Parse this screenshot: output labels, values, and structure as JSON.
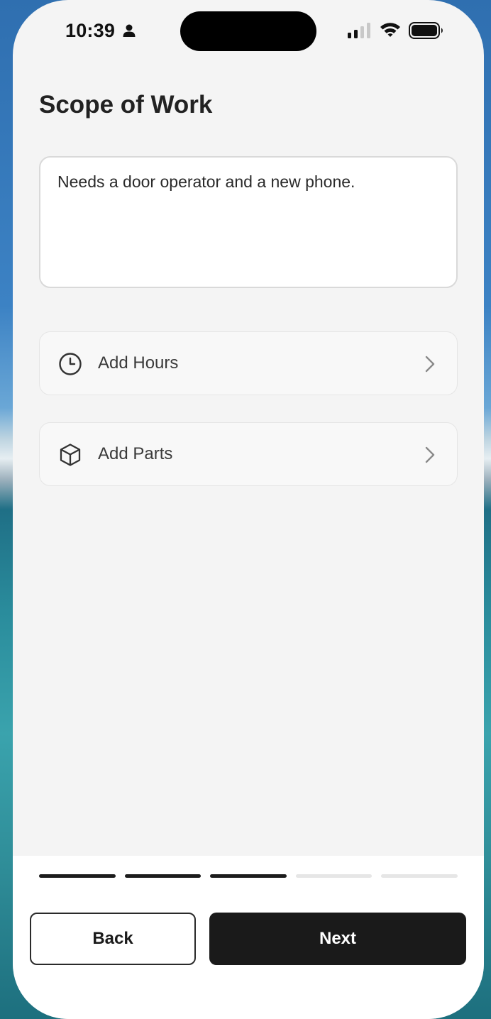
{
  "status_bar": {
    "time": "10:39",
    "icons": [
      "person-icon",
      "signal-icon",
      "wifi-icon",
      "battery-icon"
    ]
  },
  "page": {
    "title": "Scope of Work"
  },
  "scope": {
    "value": "Needs a door operator and a new phone."
  },
  "rows": [
    {
      "label": "Add Hours",
      "icon": "clock-icon"
    },
    {
      "label": "Add Parts",
      "icon": "box-icon"
    }
  ],
  "progress": {
    "total_steps": 5,
    "completed_steps": 3
  },
  "actions": {
    "back_label": "Back",
    "next_label": "Next"
  },
  "colors": {
    "primary": "#1a1a1a",
    "background": "#f4f4f4",
    "surface": "#ffffff"
  }
}
